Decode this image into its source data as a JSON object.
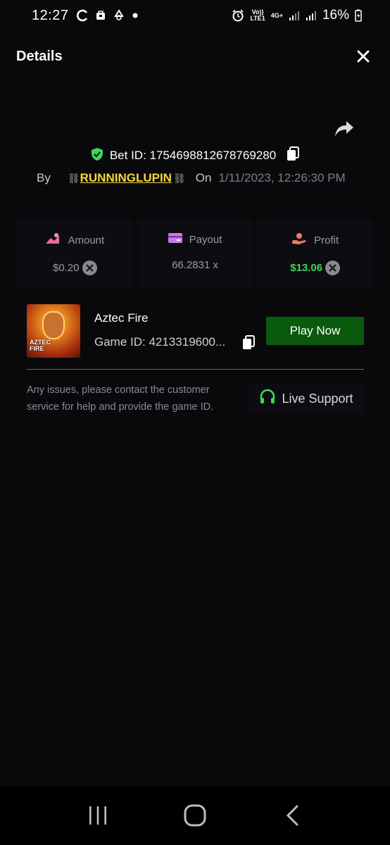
{
  "status_bar": {
    "time": "12:27",
    "network_top": "Vo))",
    "network_bottom": "LTE1",
    "network2": "4G+",
    "battery": "16%"
  },
  "header": {
    "title": "Details"
  },
  "bet": {
    "label": "Bet ID: 1754698812678769280",
    "by_label": "By",
    "chain_left": "⛓",
    "chain_right": "⛓",
    "username": "RUNNINGLUPIN",
    "on_label": "On",
    "datetime": "1/11/2023, 12:26:30 PM"
  },
  "stats": {
    "amount": {
      "label": "Amount",
      "value": "$0.20"
    },
    "payout": {
      "label": "Payout",
      "value": "66.2831 x"
    },
    "profit": {
      "label": "Profit",
      "value": "$13.06"
    }
  },
  "game": {
    "name": "Aztec Fire",
    "thumb_text_1": "AZTEC",
    "thumb_text_2": "FIRE",
    "id_label": "Game ID: 4213319600...",
    "play_label": "Play Now"
  },
  "support": {
    "text": "Any issues, please contact the customer service for help and provide the game ID.",
    "button_label": "Live Support"
  },
  "colors": {
    "background": "#09090c",
    "accent_green": "#0a5a0e",
    "profit_green": "#3dd65a",
    "username_yellow": "#f4d93a"
  }
}
